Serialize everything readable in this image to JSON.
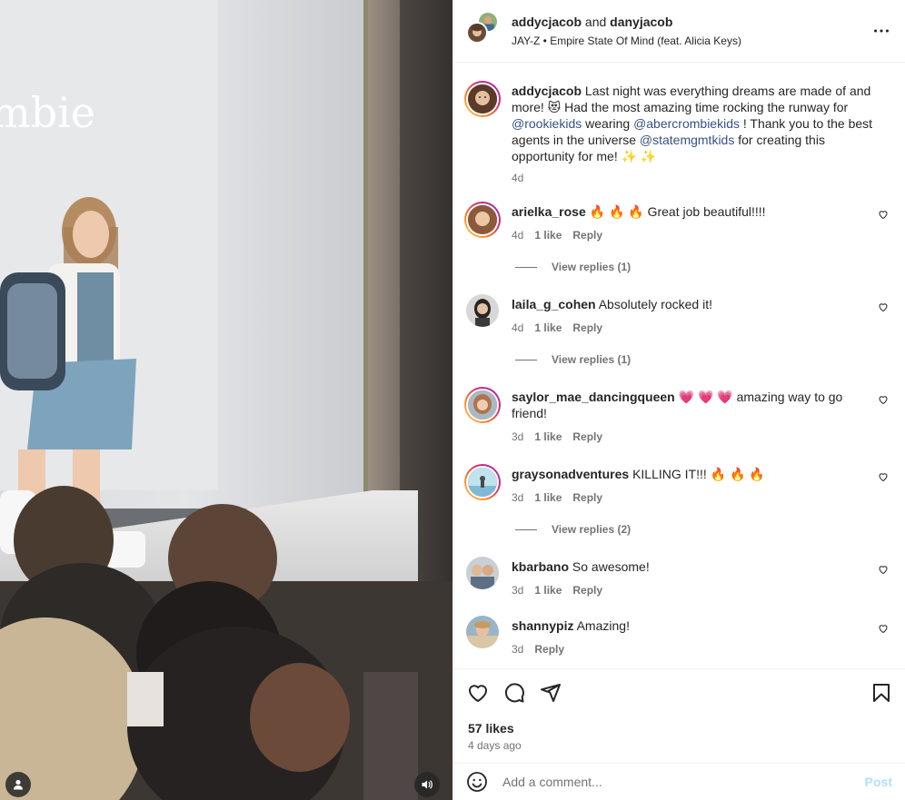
{
  "header": {
    "user1": "addycjacob",
    "and_text": "and",
    "user2": "danyjacob",
    "audio": "JAY-Z • Empire State Of Mind (feat. Alicia Keys)"
  },
  "media": {
    "backdrop_text": "mbie"
  },
  "caption": {
    "user": "addycjacob",
    "text_before_1": " Last night was everything dreams are made of and more! 😻 Had the most amazing time rocking the runway for ",
    "mention1": "@rookiekids",
    "text_mid_1": " wearing ",
    "mention2": "@abercrombiekids",
    "text_mid_2": " ! Thank you to the best agents in the universe ",
    "mention3": "@statemgmtkids",
    "text_after": " for creating this opportunity for me! ✨ ✨",
    "time": "4d"
  },
  "comments": [
    {
      "user": "arielka_rose",
      "text": "🔥 🔥 🔥 Great job beautiful!!!!",
      "time": "4d",
      "likes": "1 like",
      "reply": "Reply",
      "view_replies": "View replies (1)"
    },
    {
      "user": "laila_g_cohen",
      "text": "Absolutely rocked it!",
      "time": "4d",
      "likes": "1 like",
      "reply": "Reply",
      "view_replies": "View replies (1)"
    },
    {
      "user": "saylor_mae_dancingqueen",
      "text": "💗 💗 💗 amazing way to go friend!",
      "time": "3d",
      "likes": "1 like",
      "reply": "Reply"
    },
    {
      "user": "graysonadventures",
      "text": "KILLING IT!!! 🔥 🔥 🔥",
      "time": "3d",
      "likes": "1 like",
      "reply": "Reply",
      "view_replies": "View replies (2)"
    },
    {
      "user": "kbarbano",
      "text": "So awesome!",
      "time": "3d",
      "likes": "1 like",
      "reply": "Reply"
    },
    {
      "user": "shannypiz",
      "text": "Amazing!",
      "time": "3d",
      "reply": "Reply"
    }
  ],
  "footer": {
    "likes": "57 likes",
    "ago": "4 days ago",
    "comment_placeholder": "Add a comment...",
    "post_label": "Post"
  },
  "colors": {
    "link": "#385185",
    "muted": "#737373",
    "post_disabled": "#b2dffc"
  }
}
